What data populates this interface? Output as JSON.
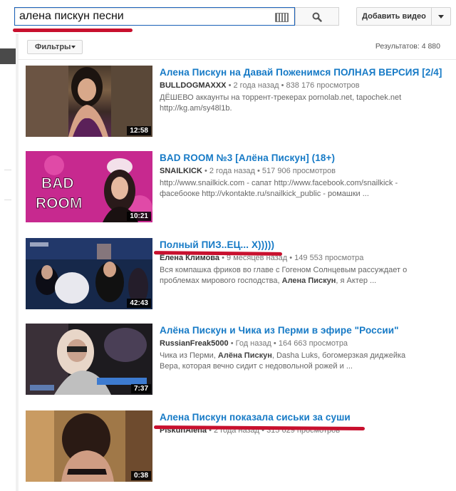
{
  "header": {
    "search_value": "алена пискун песни",
    "add_video_label": "Добавить видео"
  },
  "toolbar": {
    "filters_label": "Фильтры",
    "results_label": "Результатов: 4 880"
  },
  "videos": [
    {
      "title": "Алена Пискун на Давай Поженимся ПОЛНАЯ ВЕРСИЯ [2/4]",
      "channel": "BULLDOGMAXXX",
      "age": "2 года назад",
      "views": "838 176 просмотров",
      "desc_line1": "ДЁШЕВО аккаунты на торрент-трекерах pornolab.net, tapochek.net",
      "desc_line2": "http://kg.am/sy48l1b.",
      "duration": "12:58"
    },
    {
      "title": "BAD ROOM №3 [Алёна Пискун] (18+)",
      "channel": "SNAILKICK",
      "age": "2 года назад",
      "views": "517 906 просмотров",
      "desc_line1": "http://www.snailkick.com - сапат http://www.facebook.com/snailkick -",
      "desc_line2": "фасебооке http://vkontakte.ru/snailkick_public - ромашки ...",
      "duration": "10:21",
      "thumb_text": "BAD ROOM"
    },
    {
      "title": "Полный ПИЗ..ЕЦ... X)))))",
      "channel": "Елена Климова",
      "age": "9 месяцев назад",
      "views": "149 553 просмотра",
      "desc_line1": "Вся компашка фриков во главе с Гогеном Солнцевым рассуждает о",
      "desc_line2_pre": "проблемах мирового господства, ",
      "desc_line2_bold": "Алена Пискун",
      "desc_line2_post": ", я Актер ...",
      "duration": "42:43"
    },
    {
      "title": "Алёна Пискун и Чика из Перми в эфире \"России\"",
      "channel": "RussianFreak5000",
      "age": "Год назад",
      "views": "164 663 просмотра",
      "desc_line1_pre": "Чика из Перми, ",
      "desc_line1_bold": "Алёна Пискун",
      "desc_line1_post": ", Dasha Luks, богомерзкая диджейка",
      "desc_line2": "Вера, которая вечно сидит с недовольной рожей и ...",
      "duration": "7:37"
    },
    {
      "title": "Алена Пискун показала сиськи за суши",
      "channel": "PiskunAlena",
      "age": "2 года назад",
      "views": "315 629 просмотров",
      "duration": "0:38"
    }
  ],
  "colors": {
    "accent_link": "#167ac6",
    "annotation_red": "#c8102e"
  }
}
